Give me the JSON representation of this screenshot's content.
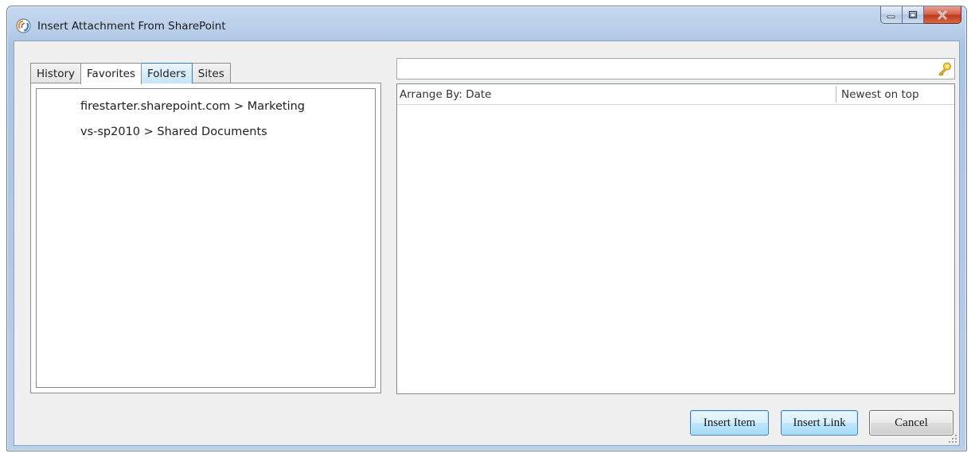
{
  "window": {
    "title": "Insert Attachment From SharePoint"
  },
  "icons": {
    "app": "sharepoint-app-icon",
    "minimize": "minimize-icon",
    "maximize": "maximize-icon",
    "close": "close-icon",
    "search": "search-key-icon",
    "resize": "resize-grip-icon"
  },
  "tabs": [
    {
      "label": "History"
    },
    {
      "label": "Favorites"
    },
    {
      "label": "Folders"
    },
    {
      "label": "Sites"
    }
  ],
  "favorites": {
    "items": [
      {
        "label": "firestarter.sharepoint.com > Marketing"
      },
      {
        "label": "vs-sp2010 > Shared Documents"
      }
    ]
  },
  "search": {
    "value": "",
    "placeholder": ""
  },
  "results": {
    "arrange_label": "Arrange By: Date",
    "sort_label": "Newest on top"
  },
  "buttons": {
    "insert_item": "Insert Item",
    "insert_link": "Insert Link",
    "cancel": "Cancel"
  },
  "colors": {
    "title_bar": "#b9cfe9",
    "close_button": "#c2391d",
    "focus_accent": "#3c7fb1"
  }
}
